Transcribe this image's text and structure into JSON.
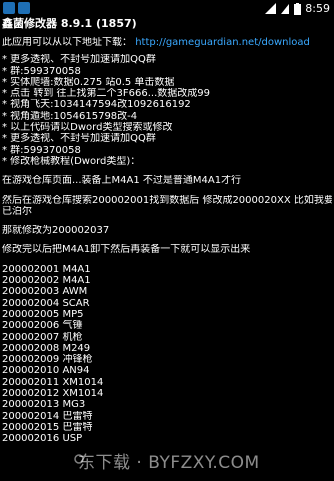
{
  "status_bar": {
    "time": "8:59",
    "colors": {
      "app_icon": "#1e6fb5"
    }
  },
  "app": {
    "title": "鑫菌修改器 8.9.1 (1857)"
  },
  "download": {
    "label": "此应用可以从以下地址下载：",
    "url": "http://gameguardian.net/download"
  },
  "lines_a": [
    "* 更多透视、不封号加速请加QQ群",
    "* 群:599370058",
    "* 实体爬墙:数据0.275 站0.5 单击数据",
    "* 点击 转到 往上找第二个3F666...数据改成99",
    "* 视角飞天:1034147594改1092616192",
    "* 视角遁地:1054615798改-4",
    "* 以上代码请以Dword类型搜索或修改",
    "* 更多透视、不封号加速请加QQ群",
    "* 群:599370058",
    "* 修改枪械教程(Dword类型)："
  ],
  "para1": "在游戏仓库页面...装备上M4A1 不过是普通M4A1才行",
  "para2": [
    "然后在游戏仓库搜索200002001找到数据后 修改成2000020XX 比如我要改",
    "已泊尔"
  ],
  "para3": "那就修改为200002037",
  "para4": "修改完以后把M4A1卸下然后再装备一下就可以显示出来",
  "weapons": [
    "200002001 M4A1",
    "200002002 M4A1",
    "200002003 AWM",
    "200002004 SCAR",
    "200002005 MP5",
    "200002006 气锤",
    "200002007 机枪",
    "200002008 M249",
    "200002009 冲锋枪",
    "200002010 AN94",
    "200002011 XM1014",
    "200002012 XM1014",
    "200002013 MG3",
    "200002014 巴雷特",
    "200002015 巴雷特",
    "200002016 USP"
  ],
  "watermark": "东下载 · BYFZXY.COM"
}
